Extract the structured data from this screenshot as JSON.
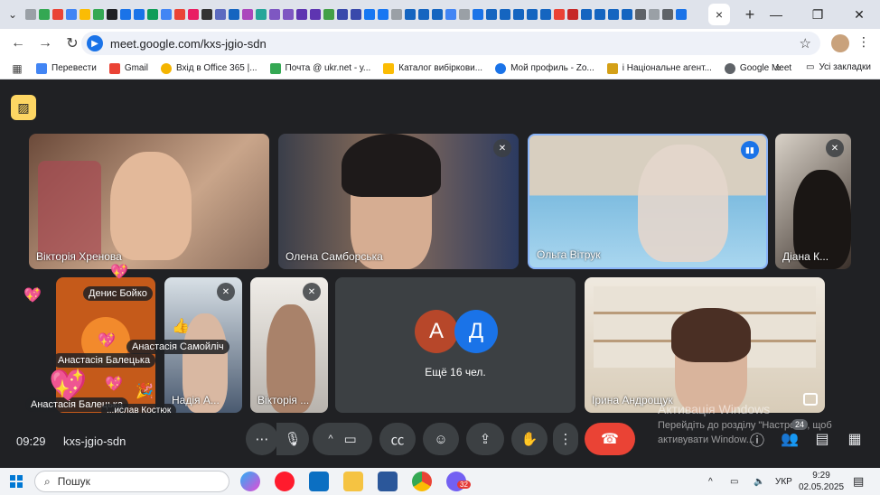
{
  "browser": {
    "url": "meet.google.com/kxs-jgio-sdn",
    "bookmarks": [
      {
        "label": "Перевести",
        "color": "#4285f4"
      },
      {
        "label": "Gmail",
        "color": "#ea4335"
      },
      {
        "label": "Вхід в Office 365 |...",
        "color": "#f4b400"
      },
      {
        "label": "Почта @ ukr.net - у...",
        "color": "#34a853"
      },
      {
        "label": "Каталог вибіркови...",
        "color": "#fbbc04"
      },
      {
        "label": "Мой профиль - Zo...",
        "color": "#1a73e8"
      },
      {
        "label": "і Національне агент...",
        "color": "#d4a017"
      },
      {
        "label": "Google Meet",
        "color": "#5f6368"
      }
    ],
    "all_bookmarks_label": "Усі закладки",
    "more_glyph": "»",
    "tab_close_glyph": "×",
    "new_tab_glyph": "+"
  },
  "participants": [
    {
      "name": "Вікторія Хренова"
    },
    {
      "name": "Олена Самборська"
    },
    {
      "name": "Ольга Вітрук"
    },
    {
      "name": "Діана К..."
    },
    {
      "name": "Надія А..."
    },
    {
      "name": "Вікторія ..."
    },
    {
      "name": "Ірина Андрощук"
    }
  ],
  "overlay_names": {
    "denys": "Денис Бойко",
    "samoilich": "Анастасія Самойліч",
    "baletska1": "Анастасія Балецька",
    "baletska2": "Анастасія Балецька",
    "kostiuk": "...ислав Костюк"
  },
  "more_tile": {
    "avatar_a": "А",
    "avatar_d": "Д",
    "text": "Ещё 16 чел."
  },
  "meeting": {
    "time": "09:29",
    "code": "kxs-jgio-sdn",
    "people_count": "24"
  },
  "windows_watermark": {
    "title": "Активація Windows",
    "line1": "Перейдіть до розділу \"Настро...\", щоб",
    "line2": "активувати Window..."
  },
  "taskbar": {
    "search_placeholder": "Пошук",
    "lang": "УКР",
    "clock_time": "9:29",
    "clock_date": "02.05.2025",
    "viber_badge": "32"
  }
}
